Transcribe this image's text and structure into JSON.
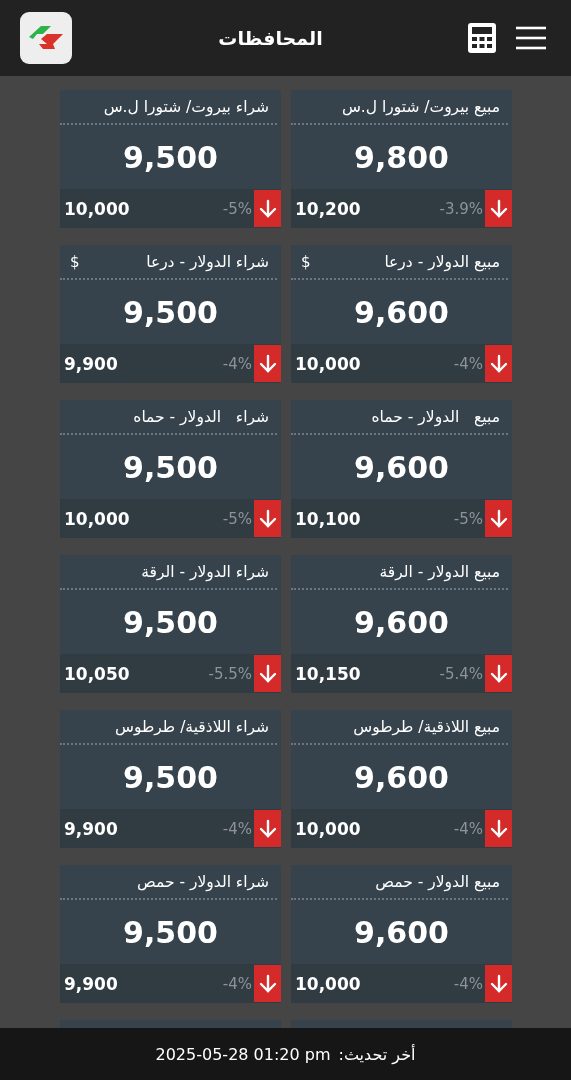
{
  "header": {
    "title": "المحافظات"
  },
  "sell_cards": [
    {
      "title": "مبيع بيروت/ شتورا ل.س",
      "value": "9,800",
      "previous": "10,200",
      "change": "-3.9%",
      "falling": true
    },
    {
      "title": "مبيع الدولار - درعا",
      "currency": "$",
      "value": "9,600",
      "previous": "10,000",
      "change": "-4%",
      "falling": true
    },
    {
      "title": "مبيع   الدولار - حماه",
      "value": "9,600",
      "previous": "10,100",
      "change": "-5%",
      "falling": true
    },
    {
      "title": "مبيع الدولار - الرقة",
      "value": "9,600",
      "previous": "10,150",
      "change": "-5.4%",
      "falling": true
    },
    {
      "title": "مبيع اللاذقية/ طرطوس",
      "value": "9,600",
      "previous": "10,000",
      "change": "-4%",
      "falling": true
    },
    {
      "title": "مبيع الدولار - حمص",
      "value": "9,600",
      "previous": "10,000",
      "change": "-4%",
      "falling": true
    }
  ],
  "buy_cards": [
    {
      "title": "شراء بيروت/ شتورا ل.س",
      "value": "9,500",
      "previous": "10,000",
      "change": "-5%",
      "falling": true
    },
    {
      "title": "شراء الدولار - درعا",
      "currency": "$",
      "value": "9,500",
      "previous": "9,900",
      "change": "-4%",
      "falling": true
    },
    {
      "title": "شراء   الدولار - حماه",
      "value": "9,500",
      "previous": "10,000",
      "change": "-5%",
      "falling": true
    },
    {
      "title": "شراء الدولار - الرقة",
      "value": "9,500",
      "previous": "10,050",
      "change": "-5.5%",
      "falling": true
    },
    {
      "title": "شراء اللاذقية/ طرطوس",
      "value": "9,500",
      "previous": "9,900",
      "change": "-4%",
      "falling": true
    },
    {
      "title": "شراء الدولار - حمص",
      "value": "9,500",
      "previous": "9,900",
      "change": "-4%",
      "falling": true
    }
  ],
  "footer": {
    "label": "أخر تحديث:",
    "timestamp": "2025-05-28 01:20 pm"
  }
}
